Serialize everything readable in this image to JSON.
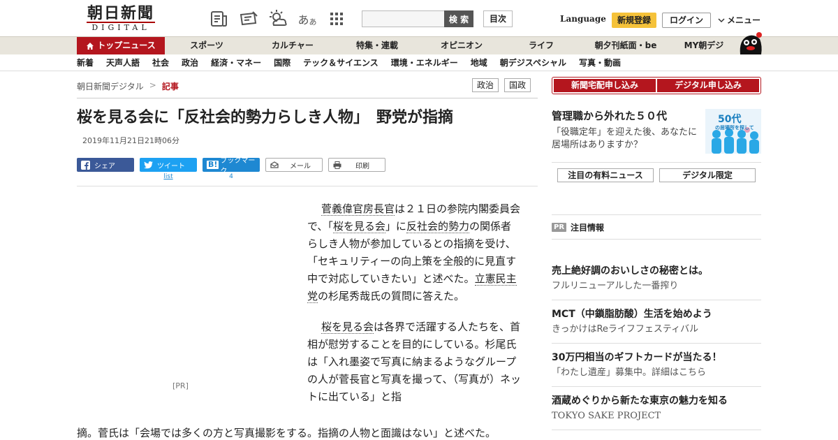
{
  "header": {
    "logo_jp": "朝日新聞",
    "logo_en": "DIGITAL",
    "search_placeholder": "",
    "search_button": "検 索",
    "contents_button": "目次",
    "language": "Language",
    "register": "新規登録",
    "login": "ログイン",
    "menu": "メニュー",
    "font_size_glyph": "あ",
    "font_size_glyph_small": "あ"
  },
  "nav_primary": [
    {
      "label": "トップニュース",
      "active": true
    },
    {
      "label": "スポーツ"
    },
    {
      "label": "カルチャー"
    },
    {
      "label": "特集・連載"
    },
    {
      "label": "オピニオン"
    },
    {
      "label": "ライフ"
    },
    {
      "label": "朝夕刊紙面・be"
    },
    {
      "label": "MY朝デジ"
    }
  ],
  "nav_secondary": [
    "新着",
    "天声人語",
    "社会",
    "政治",
    "経済・マネー",
    "国際",
    "テック＆サイエンス",
    "環境・エネルギー",
    "地域",
    "朝デジスペシャル",
    "写真・動画"
  ],
  "breadcrumb": {
    "home": "朝日新聞デジタル",
    "sep": ">",
    "current": "記事"
  },
  "tags": [
    "政治",
    "国政"
  ],
  "article": {
    "headline": "桜を見る会に「反社会的勢力らしき人物」　野党が指摘",
    "date": "2019年11月21日21時06分",
    "pr_label": "[PR]",
    "p1": {
      "link1": "菅義偉官房長官",
      "t1": "は２１日の参院内閣委員会で、「",
      "link2": "桜を見る会",
      "t2": "」に",
      "link3": "反社会的勢力",
      "t3": "の関係者らしき人物が参加しているとの指摘を受け、「セキュリティーの向上策を全般的に見直す中で対応していきたい」と述べた。",
      "link4": "立憲民主党",
      "t4": "の杉尾秀哉氏の質問に答えた。"
    },
    "p2": {
      "link1": "桜を見る会",
      "t1": "は各界で活躍する人たちを、首相が慰労することを目的にしている。杉尾氏は「入れ墨姿で写真に納まるようなグループの人が菅長官と写真を撮って、（写真が）ネットに出ている」と指"
    },
    "p2_wide": "摘。菅氏は「会場では多くの方と写真撮影をする。指摘の人物と面識はない」と述べた。"
  },
  "share": {
    "facebook": "シェア",
    "twitter": "ツイート",
    "twitter_count": "list",
    "hatena": "ブックマーク",
    "hatena_count": "4",
    "mail": "メール",
    "print": "印刷"
  },
  "sidebar": {
    "sub_newspaper": "新聞宅配申し込み",
    "sub_digital": "デジタル申し込み",
    "feature_title": "管理職から外れた５０代",
    "feature_desc": "「役職定年」を迎えた後、あなたに居場所はありますか？",
    "feature_img_big": "50代",
    "feature_img_small": "の居場所を探して",
    "tab_paid": "注目の有料ニュース",
    "tab_digital": "デジタル限定",
    "pr_badge": "PR",
    "pr_title": "注目情報",
    "promos": [
      {
        "title": "売上絶好調のおいしさの秘密とは。",
        "sub": "フルリニューアルした一番搾り"
      },
      {
        "title": "MCT（中鎖脂肪酸）生活を始めよう",
        "sub": "きっかけはReライフフェスティバル"
      },
      {
        "title": "30万円相当のギフトカードが当たる！",
        "sub": "「わたし遺産」募集中。詳細はこちら"
      },
      {
        "title": "酒蔵めぐりから新たな東京の魅力を知る",
        "sub": "TOKYO SAKE PROJECT"
      }
    ]
  },
  "colors": {
    "brand_red": "#b4161e",
    "register_yellow": "#f5c23a",
    "nav_beige": "#e8e5dc"
  }
}
